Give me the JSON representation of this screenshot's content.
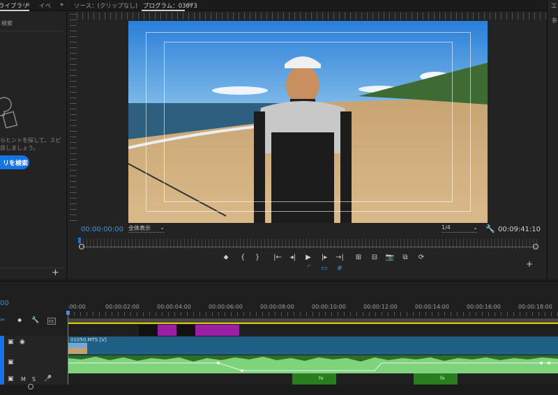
{
  "left_panel": {
    "tabs": [
      "ライブラリ",
      "イベ"
    ],
    "tab_menu": "≡",
    "collapse": "»",
    "search_label": "検索",
    "hint_line1": "らヒントを探して、スピ",
    "hint_line2": "良しましょう。",
    "search_button": "リを検索",
    "add": "+"
  },
  "program_panel": {
    "source_tab": "ソース：(クリップなし)",
    "program_tab": "プログラム：03673",
    "tab_menu": "≡",
    "timecode_current": "00:00:00:00",
    "zoom_select": "全体表示",
    "resolution_select": "1/4",
    "timecode_duration": "00:09:41:10",
    "transport": [
      "⬥",
      "{",
      "}",
      "|←",
      "◂|",
      "▶",
      "|▸",
      "→|",
      "⊞",
      "⊟",
      "📷",
      "⧉",
      "⟳"
    ],
    "add": "+"
  },
  "right_panel": {
    "tab_label": "エ",
    "sub_label": "参"
  },
  "timeline": {
    "timecode": "00",
    "ruler_labels": [
      ":00:00",
      "00:00:02:00",
      "00:00:04:00",
      "00:00:06:00",
      "00:00:08:00",
      "00:00:10:00",
      "00:00:12:00",
      "00:00:14:00",
      "00:00:16:00",
      "00:00:18:00"
    ],
    "video_clip_name": "01050.MTS [V]",
    "track_v_label": "",
    "track_a_labels": [
      "M",
      "S"
    ],
    "fx": "fx"
  },
  "colors": {
    "accent": "#1473e6",
    "timecode_blue": "#3d8fe0",
    "video_clip": "#1e5f86",
    "audio_clip": "#7fd37a",
    "marker_purple": "#9b1fa5",
    "work_area": "#e8d000"
  }
}
